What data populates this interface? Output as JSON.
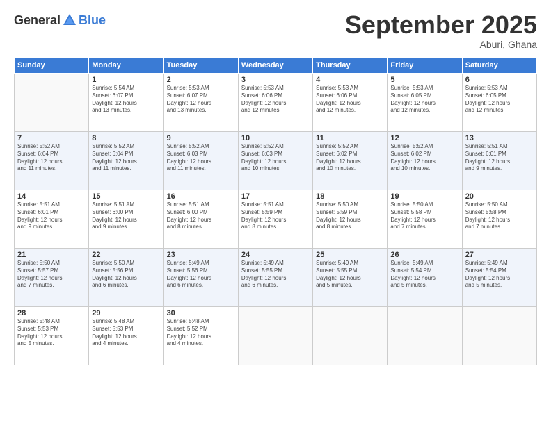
{
  "logo": {
    "text1": "General",
    "text2": "Blue"
  },
  "header": {
    "month": "September 2025",
    "location": "Aburi, Ghana"
  },
  "weekdays": [
    "Sunday",
    "Monday",
    "Tuesday",
    "Wednesday",
    "Thursday",
    "Friday",
    "Saturday"
  ],
  "weeks": [
    [
      {
        "day": "",
        "sunrise": "",
        "sunset": "",
        "daylight": ""
      },
      {
        "day": "1",
        "sunrise": "Sunrise: 5:54 AM",
        "sunset": "Sunset: 6:07 PM",
        "daylight": "Daylight: 12 hours and 13 minutes."
      },
      {
        "day": "2",
        "sunrise": "Sunrise: 5:53 AM",
        "sunset": "Sunset: 6:07 PM",
        "daylight": "Daylight: 12 hours and 13 minutes."
      },
      {
        "day": "3",
        "sunrise": "Sunrise: 5:53 AM",
        "sunset": "Sunset: 6:06 PM",
        "daylight": "Daylight: 12 hours and 12 minutes."
      },
      {
        "day": "4",
        "sunrise": "Sunrise: 5:53 AM",
        "sunset": "Sunset: 6:06 PM",
        "daylight": "Daylight: 12 hours and 12 minutes."
      },
      {
        "day": "5",
        "sunrise": "Sunrise: 5:53 AM",
        "sunset": "Sunset: 6:05 PM",
        "daylight": "Daylight: 12 hours and 12 minutes."
      },
      {
        "day": "6",
        "sunrise": "Sunrise: 5:53 AM",
        "sunset": "Sunset: 6:05 PM",
        "daylight": "Daylight: 12 hours and 12 minutes."
      }
    ],
    [
      {
        "day": "7",
        "sunrise": "Sunrise: 5:52 AM",
        "sunset": "Sunset: 6:04 PM",
        "daylight": "Daylight: 12 hours and 11 minutes."
      },
      {
        "day": "8",
        "sunrise": "Sunrise: 5:52 AM",
        "sunset": "Sunset: 6:04 PM",
        "daylight": "Daylight: 12 hours and 11 minutes."
      },
      {
        "day": "9",
        "sunrise": "Sunrise: 5:52 AM",
        "sunset": "Sunset: 6:03 PM",
        "daylight": "Daylight: 12 hours and 11 minutes."
      },
      {
        "day": "10",
        "sunrise": "Sunrise: 5:52 AM",
        "sunset": "Sunset: 6:03 PM",
        "daylight": "Daylight: 12 hours and 10 minutes."
      },
      {
        "day": "11",
        "sunrise": "Sunrise: 5:52 AM",
        "sunset": "Sunset: 6:02 PM",
        "daylight": "Daylight: 12 hours and 10 minutes."
      },
      {
        "day": "12",
        "sunrise": "Sunrise: 5:52 AM",
        "sunset": "Sunset: 6:02 PM",
        "daylight": "Daylight: 12 hours and 10 minutes."
      },
      {
        "day": "13",
        "sunrise": "Sunrise: 5:51 AM",
        "sunset": "Sunset: 6:01 PM",
        "daylight": "Daylight: 12 hours and 9 minutes."
      }
    ],
    [
      {
        "day": "14",
        "sunrise": "Sunrise: 5:51 AM",
        "sunset": "Sunset: 6:01 PM",
        "daylight": "Daylight: 12 hours and 9 minutes."
      },
      {
        "day": "15",
        "sunrise": "Sunrise: 5:51 AM",
        "sunset": "Sunset: 6:00 PM",
        "daylight": "Daylight: 12 hours and 9 minutes."
      },
      {
        "day": "16",
        "sunrise": "Sunrise: 5:51 AM",
        "sunset": "Sunset: 6:00 PM",
        "daylight": "Daylight: 12 hours and 8 minutes."
      },
      {
        "day": "17",
        "sunrise": "Sunrise: 5:51 AM",
        "sunset": "Sunset: 5:59 PM",
        "daylight": "Daylight: 12 hours and 8 minutes."
      },
      {
        "day": "18",
        "sunrise": "Sunrise: 5:50 AM",
        "sunset": "Sunset: 5:59 PM",
        "daylight": "Daylight: 12 hours and 8 minutes."
      },
      {
        "day": "19",
        "sunrise": "Sunrise: 5:50 AM",
        "sunset": "Sunset: 5:58 PM",
        "daylight": "Daylight: 12 hours and 7 minutes."
      },
      {
        "day": "20",
        "sunrise": "Sunrise: 5:50 AM",
        "sunset": "Sunset: 5:58 PM",
        "daylight": "Daylight: 12 hours and 7 minutes."
      }
    ],
    [
      {
        "day": "21",
        "sunrise": "Sunrise: 5:50 AM",
        "sunset": "Sunset: 5:57 PM",
        "daylight": "Daylight: 12 hours and 7 minutes."
      },
      {
        "day": "22",
        "sunrise": "Sunrise: 5:50 AM",
        "sunset": "Sunset: 5:56 PM",
        "daylight": "Daylight: 12 hours and 6 minutes."
      },
      {
        "day": "23",
        "sunrise": "Sunrise: 5:49 AM",
        "sunset": "Sunset: 5:56 PM",
        "daylight": "Daylight: 12 hours and 6 minutes."
      },
      {
        "day": "24",
        "sunrise": "Sunrise: 5:49 AM",
        "sunset": "Sunset: 5:55 PM",
        "daylight": "Daylight: 12 hours and 6 minutes."
      },
      {
        "day": "25",
        "sunrise": "Sunrise: 5:49 AM",
        "sunset": "Sunset: 5:55 PM",
        "daylight": "Daylight: 12 hours and 5 minutes."
      },
      {
        "day": "26",
        "sunrise": "Sunrise: 5:49 AM",
        "sunset": "Sunset: 5:54 PM",
        "daylight": "Daylight: 12 hours and 5 minutes."
      },
      {
        "day": "27",
        "sunrise": "Sunrise: 5:49 AM",
        "sunset": "Sunset: 5:54 PM",
        "daylight": "Daylight: 12 hours and 5 minutes."
      }
    ],
    [
      {
        "day": "28",
        "sunrise": "Sunrise: 5:48 AM",
        "sunset": "Sunset: 5:53 PM",
        "daylight": "Daylight: 12 hours and 5 minutes."
      },
      {
        "day": "29",
        "sunrise": "Sunrise: 5:48 AM",
        "sunset": "Sunset: 5:53 PM",
        "daylight": "Daylight: 12 hours and 4 minutes."
      },
      {
        "day": "30",
        "sunrise": "Sunrise: 5:48 AM",
        "sunset": "Sunset: 5:52 PM",
        "daylight": "Daylight: 12 hours and 4 minutes."
      },
      {
        "day": "",
        "sunrise": "",
        "sunset": "",
        "daylight": ""
      },
      {
        "day": "",
        "sunrise": "",
        "sunset": "",
        "daylight": ""
      },
      {
        "day": "",
        "sunrise": "",
        "sunset": "",
        "daylight": ""
      },
      {
        "day": "",
        "sunrise": "",
        "sunset": "",
        "daylight": ""
      }
    ]
  ]
}
